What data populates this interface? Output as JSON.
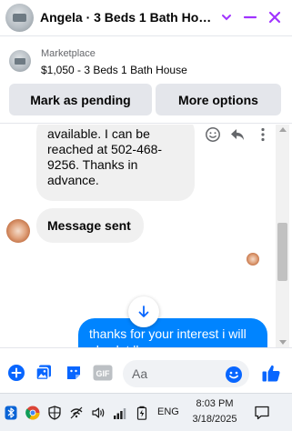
{
  "header": {
    "title": "Angela · 3 Beds 1 Bath House",
    "accent_color": "#a033ff"
  },
  "marketplace": {
    "label": "Marketplace",
    "item": "$1,050 - 3 Beds 1 Bath House",
    "mark_pending_label": "Mark as pending",
    "more_options_label": "More options"
  },
  "messages": {
    "received_1_lines": [
      "available. I can be",
      "reached at 502-468-",
      "9256. Thanks in",
      "advance."
    ],
    "received_2": "Message sent",
    "sent_1": "thanks for your interest i will also let ll",
    "sent_color": "#0084ff"
  },
  "composer": {
    "placeholder": "Aa",
    "gif_label": "GIF",
    "accent_color": "#0866ff"
  },
  "taskbar": {
    "language": "ENG",
    "time": "8:03 PM",
    "date": "3/18/2025",
    "icons": [
      "bluetooth-icon",
      "chrome-icon",
      "security-shield-icon",
      "network-icon",
      "volume-icon",
      "wifi-icon",
      "battery-icon",
      "notifications-icon"
    ]
  }
}
